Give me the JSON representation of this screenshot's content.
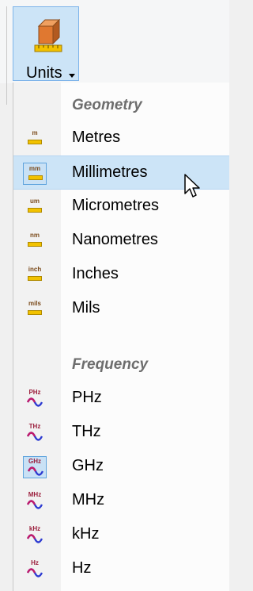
{
  "toolbar": {
    "units_label": "Units"
  },
  "menu": {
    "sections": {
      "geometry": {
        "header": "Geometry",
        "items": [
          {
            "label": "Metres",
            "icon": "metres-ruler-icon",
            "unit": "m"
          },
          {
            "label": "Millimetres",
            "icon": "millimetres-ruler-icon",
            "unit": "mm",
            "selected": true,
            "hovered": true
          },
          {
            "label": "Micrometres",
            "icon": "micrometres-ruler-icon",
            "unit": "um"
          },
          {
            "label": "Nanometres",
            "icon": "nanometres-ruler-icon",
            "unit": "nm"
          },
          {
            "label": "Inches",
            "icon": "inches-ruler-icon",
            "unit": "inch"
          },
          {
            "label": "Mils",
            "icon": "mils-ruler-icon",
            "unit": "mils"
          }
        ]
      },
      "frequency": {
        "header": "Frequency",
        "items": [
          {
            "label": "PHz",
            "icon": "phz-wave-icon",
            "unit": "PHz"
          },
          {
            "label": "THz",
            "icon": "thz-wave-icon",
            "unit": "THz"
          },
          {
            "label": "GHz",
            "icon": "ghz-wave-icon",
            "unit": "GHz",
            "selected": true
          },
          {
            "label": "MHz",
            "icon": "mhz-wave-icon",
            "unit": "MHz"
          },
          {
            "label": "kHz",
            "icon": "khz-wave-icon",
            "unit": "kHz"
          },
          {
            "label": "Hz",
            "icon": "hz-wave-icon",
            "unit": "Hz"
          }
        ]
      }
    }
  },
  "colors": {
    "hover": "#cce4f7",
    "selected_border": "#5ea3dd",
    "ruler": "#f2c200",
    "wave": "#2d3bd1"
  }
}
